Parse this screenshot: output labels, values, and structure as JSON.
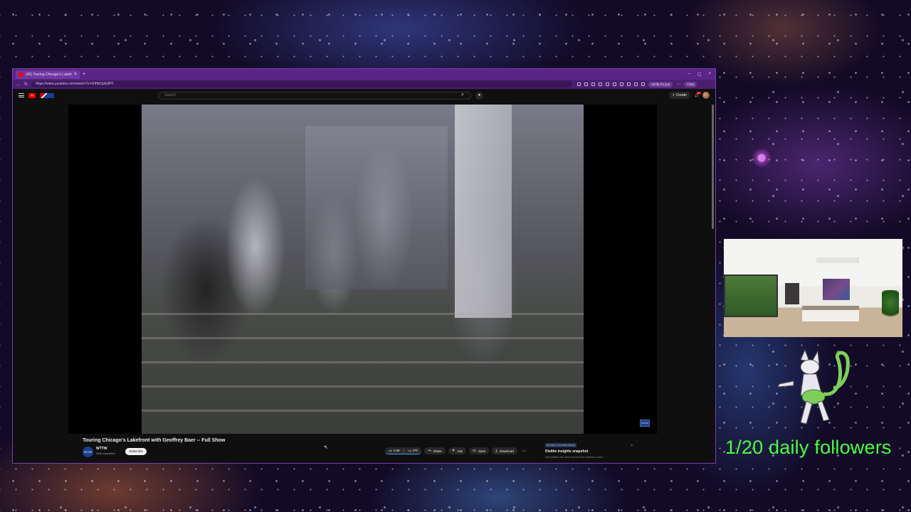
{
  "browser": {
    "tab_title": "(40) Touring Chicago's Lakefr",
    "url": "https://www.youtube.com/watch?v=3rlHbOpKdP0",
    "profile_label": "Verify it's you",
    "user_label": "Chat"
  },
  "youtube": {
    "search_placeholder": "Search",
    "create_label": "Create",
    "notification_count": "9+"
  },
  "video": {
    "title": "Touring Chicago's Lakefront with Geoffrey Baer -- Full Show",
    "channel": "WTTW",
    "channel_avatar_text": "WTTW",
    "subscribers": "254K subscribers",
    "subscribe_label": "Subscribe",
    "watermark": "WTTW",
    "actions": {
      "likes": "2.6K",
      "dislikes": "270",
      "share": "Share",
      "ask": "Ask",
      "save": "Save",
      "download": "Download"
    }
  },
  "dislike_panel": {
    "tag": "RETURN YOUTUBE DISLIKE",
    "title": "Dislike insights snapshot",
    "subtitle": "View dislikes are direct reports from extension users"
  },
  "overlay": {
    "followers_text": "1/20 daily followers"
  }
}
